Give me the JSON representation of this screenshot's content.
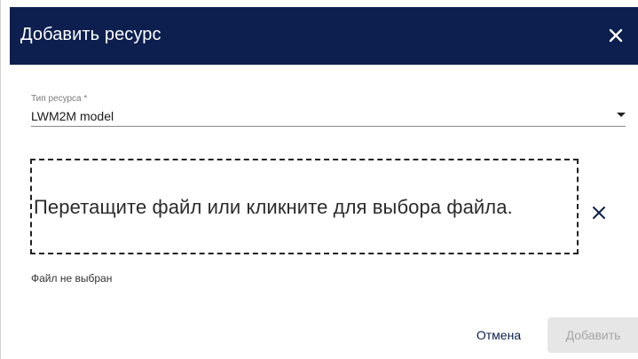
{
  "dialog": {
    "title": "Добавить ресурс",
    "close_icon": "close-icon"
  },
  "resource_type": {
    "label": "Тип ресурса *",
    "value": "LWM2M model",
    "icon": "dropdown-arrow-icon"
  },
  "dropzone": {
    "text": "Перетащите файл или кликните для выбора файла.",
    "clear_icon": "clear-icon"
  },
  "file_status": "Файл не выбран",
  "actions": {
    "cancel_label": "Отмена",
    "add_label": "Добавить",
    "add_disabled": true
  },
  "colors": {
    "header_bg": "#0c1f4f",
    "primary": "#0c1f4f",
    "disabled_bg": "#e6e6e6",
    "disabled_text": "#a6a6a6"
  }
}
